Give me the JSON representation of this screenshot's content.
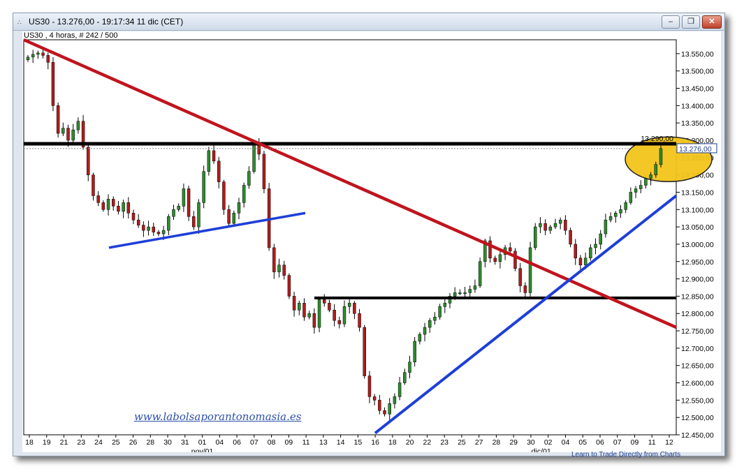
{
  "window": {
    "title": "US30 - 13.276,00 - 19:17:34  11 dic (CET)",
    "menu_glyph": "∴",
    "buttons": {
      "minimize": "–",
      "restore": "❐",
      "close": "✕"
    }
  },
  "chart": {
    "subtitle": "US30 , 4 horas, # 242 / 500",
    "watermark": "www.labolsaporantonomasia.es",
    "credit": "Learn to Trade Directly from Charts",
    "last_price_label": "13.276,00",
    "annotation_price_label": "13.290,00"
  },
  "chart_data": {
    "type": "candlestick",
    "title": "US30",
    "timeframe": "4 horas",
    "ylim": [
      12450,
      13590
    ],
    "y_ticks": [
      "13.550,00",
      "13.500,00",
      "13.450,00",
      "13.400,00",
      "13.350,00",
      "13.300,00",
      "13.250,00",
      "13.200,00",
      "13.150,00",
      "13.100,00",
      "13.050,00",
      "13.000,00",
      "12.950,00",
      "12.900,00",
      "12.850,00",
      "12.800,00",
      "12.750,00",
      "12.700,00",
      "12.650,00",
      "12.600,00",
      "12.550,00",
      "12.500,00",
      "12.450,00"
    ],
    "x_ticks": [
      "18",
      "19",
      "21",
      "23",
      "24",
      "25",
      "26",
      "28",
      "30",
      "31",
      "01",
      "04",
      "06",
      "07",
      "08",
      "09",
      "11",
      "13",
      "14",
      "15",
      "16",
      "18",
      "20",
      "22",
      "23",
      "25",
      "27",
      "28",
      "29",
      "30",
      "02",
      "04",
      "05",
      "06",
      "07",
      "09",
      "11",
      "12"
    ],
    "month_labels": [
      "nov/01",
      "dic/01"
    ],
    "close_series": [
      13540,
      13548,
      13552,
      13545,
      13525,
      13400,
      13320,
      13335,
      13300,
      13330,
      13355,
      13280,
      13200,
      13140,
      13120,
      13100,
      13130,
      13110,
      13095,
      13120,
      13090,
      13070,
      13055,
      13040,
      13050,
      13035,
      13030,
      13040,
      13080,
      13100,
      13110,
      13160,
      13080,
      13050,
      13120,
      13210,
      13270,
      13240,
      13180,
      13100,
      13060,
      13090,
      13120,
      13170,
      13210,
      13290,
      13260,
      13160,
      12990,
      12920,
      12940,
      12910,
      12850,
      12810,
      12830,
      12790,
      12800,
      12760,
      12840,
      12830,
      12810,
      12780,
      12770,
      12820,
      12830,
      12800,
      12760,
      12620,
      12560,
      12550,
      12520,
      12510,
      12540,
      12560,
      12600,
      12630,
      12660,
      12720,
      12740,
      12760,
      12780,
      12790,
      12820,
      12830,
      12850,
      12860,
      12860,
      12860,
      12870,
      12880,
      12950,
      13010,
      12960,
      12950,
      12970,
      12990,
      12980,
      12930,
      12880,
      12860,
      12990,
      13050,
      13060,
      13040,
      13050,
      13060,
      13070,
      13040,
      13000,
      12960,
      12940,
      12960,
      12990,
      13000,
      13030,
      13070,
      13080,
      13090,
      13100,
      13120,
      13150,
      13160,
      13170,
      13190,
      13200,
      13230,
      13276
    ],
    "levels": [
      {
        "type": "horizontal",
        "value": 13290,
        "color": "#000000"
      },
      {
        "type": "horizontal",
        "value": 12845,
        "color": "#000000"
      }
    ],
    "trendlines": [
      {
        "name": "resistance",
        "color": "#c0141e",
        "from": 13590,
        "to": 12760
      },
      {
        "name": "support-short",
        "color": "#1e3fd8",
        "from": 12990,
        "to": 13090
      },
      {
        "name": "support-long",
        "color": "#1e3fd8",
        "from": 12455,
        "to": 13140
      }
    ],
    "colors": {
      "up": "#2e8b2e",
      "down": "#b31b1b",
      "wick": "#000000",
      "highlight": "#f2c41a"
    }
  }
}
